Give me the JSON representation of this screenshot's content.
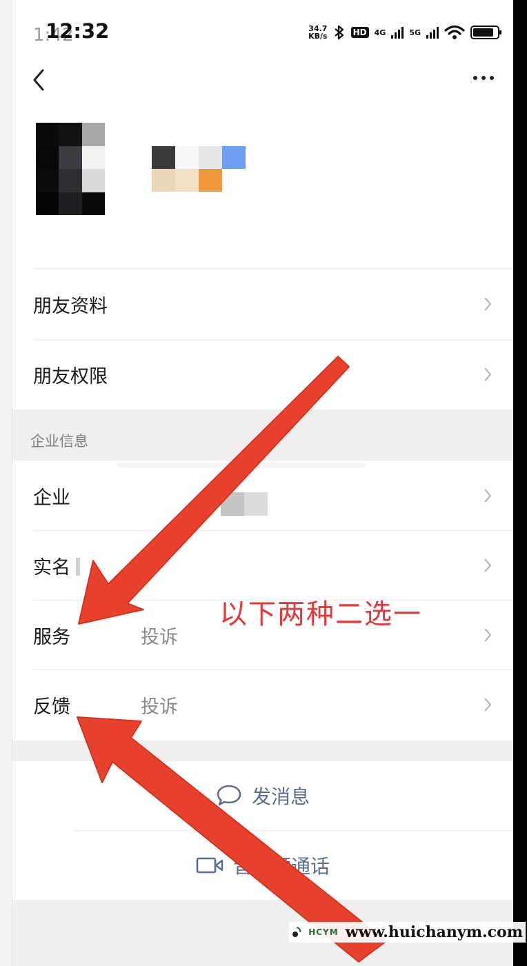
{
  "status_bar": {
    "time_ghost": "1:42",
    "time": "12:32",
    "net_speed_value": "34.7",
    "net_speed_unit": "KB/s",
    "hd_badge": "HD",
    "net1": "4G",
    "net2": "5G"
  },
  "menu": {
    "friend_info": "朋友资料",
    "friend_permission": "朋友权限"
  },
  "section": {
    "header": "企业信息"
  },
  "enterprise_rows": {
    "company": "企业",
    "real_name": "实名",
    "service_label": "服务",
    "service_value": "投诉",
    "feedback_label": "反馈",
    "feedback_value": "投诉"
  },
  "actions": {
    "send_message": "发消息",
    "av_call": "音视频通话"
  },
  "annotation": {
    "text": "以下两种二选一"
  },
  "watermark": {
    "brand": "HCYM",
    "url": "www.huichanym.com"
  },
  "colors": {
    "arrow": "#e8422f",
    "action_text": "#5a6c95",
    "annotation_text": "#e23a3a"
  }
}
